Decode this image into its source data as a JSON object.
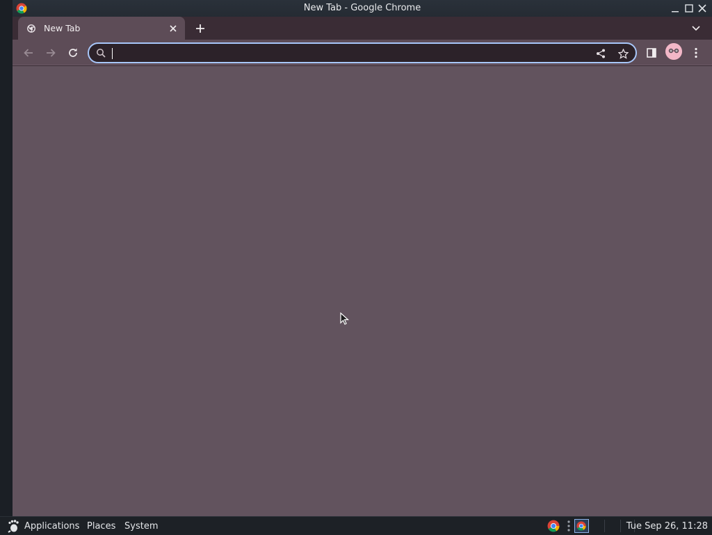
{
  "window": {
    "title": "New Tab - Google Chrome"
  },
  "tabs": [
    {
      "label": "New Tab",
      "active": true
    }
  ],
  "omnibox": {
    "value": "",
    "placeholder": ""
  },
  "taskbar": {
    "menus": [
      "Applications",
      "Places",
      "System"
    ],
    "clock": "Tue Sep 26, 11:28"
  },
  "icons": {
    "title_app": "chrome-logo",
    "tab_favicon": "chrome-newtab-favicon",
    "tab_close": "close-icon",
    "new_tab": "plus-icon",
    "tab_search": "chevron-down-icon",
    "back": "arrow-left-icon",
    "forward": "arrow-right-icon",
    "reload": "reload-icon",
    "omnibox_search": "search-icon",
    "share": "share-icon",
    "bookmark": "star-icon",
    "side_panel": "side-panel-icon",
    "profile": "avatar",
    "menu": "kebab-menu-icon"
  },
  "colors": {
    "theme_frame": "#3a2c35",
    "theme_toolbar": "#5d4c57",
    "theme_content": "#62535e",
    "omnibox_focus": "#a8c7fa",
    "taskbar": "#1d2126"
  }
}
